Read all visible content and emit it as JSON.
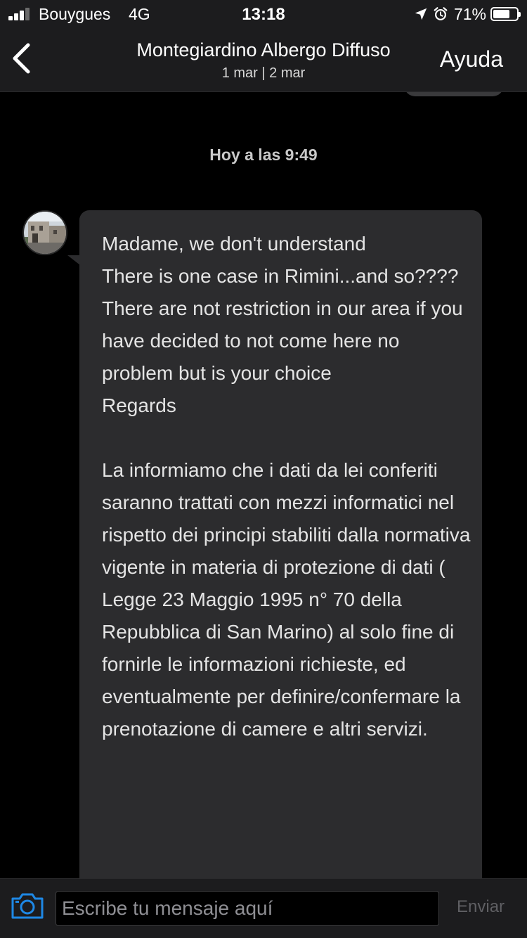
{
  "status_bar": {
    "carrier": "Bouygues",
    "network": "4G",
    "time": "13:18",
    "battery_percent": "71%",
    "battery_level": 0.71,
    "signal_bars_active": 3,
    "signal_bars_total": 4,
    "icons": [
      "signal-icon",
      "location-arrow-icon",
      "alarm-icon",
      "battery-icon"
    ]
  },
  "header": {
    "title": "Montegiardino Albergo Diffuso",
    "dates": "1 mar | 2 mar",
    "help_label": "Ayuda",
    "back_icon": "chevron-left-icon"
  },
  "chat": {
    "timestamp": "Hoy a las 9:49",
    "messages": [
      {
        "sender": "host",
        "avatar_icon": "host-avatar",
        "text": "Madame, we don't understand\nThere is one case in Rimini...and so????\nThere are not restriction in our area if you have decided to not come here no problem but is your choice\nRegards\n\nLa informiamo che i dati da lei conferiti saranno trattati con mezzi informatici nel rispetto dei principi stabiliti dalla normativa vigente in materia di protezione di dati ( Legge 23 Maggio 1995 n° 70 della Repubblica di San Marino) al solo fine di fornirle le informazioni richieste, ed eventualmente per definire/confermare la prenotazione di camere e altri servizi."
      }
    ]
  },
  "composer": {
    "placeholder": "Escribe tu mensaje aquí",
    "value": "",
    "send_label": "Enviar",
    "camera_icon": "camera-icon"
  },
  "colors": {
    "background": "#000000",
    "bar_background": "#1c1c1e",
    "bubble_background": "#2c2c2e",
    "accent_blue": "#1e88e5",
    "send_disabled": "#5f5f63"
  }
}
